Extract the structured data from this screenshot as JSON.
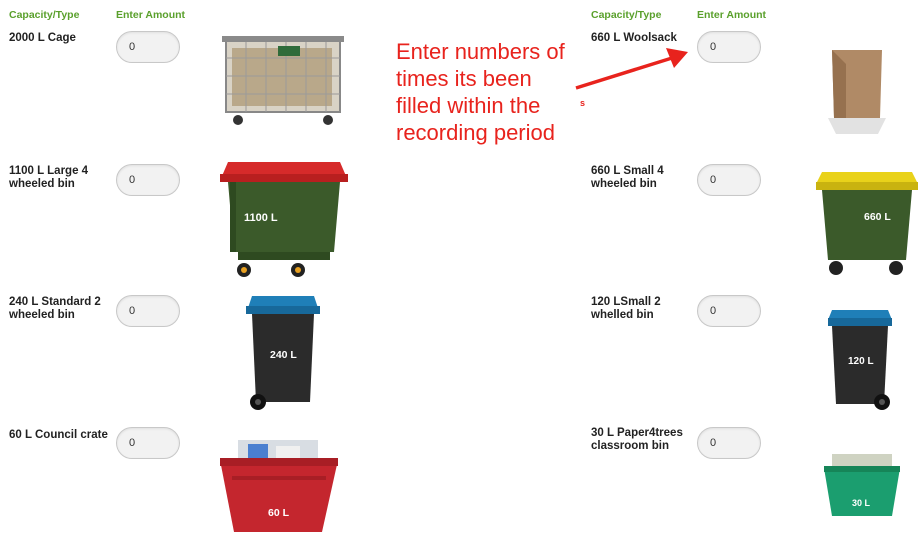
{
  "headers": {
    "left_capacity": "Capacity/Type",
    "left_amount": "Enter Amount",
    "right_capacity": "Capacity/Type",
    "right_amount": "Enter Amount"
  },
  "left_items": [
    {
      "label": "2000 L Cage",
      "value": "0"
    },
    {
      "label": "1100 L Large 4 wheeled bin",
      "value": "0",
      "bin_text": "1100 L"
    },
    {
      "label": "240 L Standard 2 wheeled bin",
      "value": "0",
      "bin_text": "240 L"
    },
    {
      "label": "60 L Council crate",
      "value": "0",
      "bin_text": "60 L"
    }
  ],
  "right_items": [
    {
      "label": "660 L Woolsack",
      "value": "0"
    },
    {
      "label": "660 L Small 4 wheeled bin",
      "value": "0",
      "bin_text": "660 L"
    },
    {
      "label": "120 LSmall 2 whelled bin",
      "value": "0",
      "bin_text": "120 L"
    },
    {
      "label": "30 L Paper4trees classroom bin",
      "value": "0",
      "bin_text": "30 L"
    }
  ],
  "annotation": {
    "text": "Enter numbers of times its been filled within the recording period",
    "stray_mark": "s",
    "color": "#e8231d"
  },
  "colors": {
    "header_green": "#5aa02c",
    "bin_green": "#3b5a2a",
    "lid_red": "#d62a2a",
    "lid_yellow": "#e9d21a",
    "lid_blue": "#1f7fb8",
    "crate_red": "#c4262e",
    "crate_teal": "#1b9e6f"
  }
}
